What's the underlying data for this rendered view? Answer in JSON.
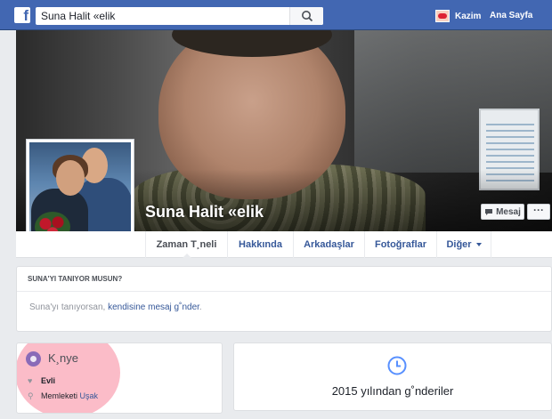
{
  "topbar": {
    "logo_letter": "f",
    "search_value": "Suna Halit «elik",
    "search_icon": "search-icon",
    "user_name": "Kazim",
    "home_label": "Ana Sayfa",
    "bar_color": "#4267b2"
  },
  "profile": {
    "name": "Suna Halit «elik",
    "message_button": "Mesaj",
    "more_button": "···"
  },
  "tabs": [
    {
      "label": "Zaman T¸neli"
    },
    {
      "label": "Hakkında"
    },
    {
      "label": "Arkadaşlar"
    },
    {
      "label": "Fotoğraflar"
    },
    {
      "label": "Diğer"
    }
  ],
  "know_card": {
    "heading": "SUNA'YI TANIYOR MUSUN?",
    "text_before": "Suna'yı tanıyorsan, ",
    "link": "kendisine mesaj g˚nder",
    "text_after": "."
  },
  "intro": {
    "title": "K¸nye",
    "icon": "globe-icon",
    "rows": [
      {
        "icon": "heart-icon",
        "label": "Evli",
        "value": ""
      },
      {
        "icon": "location-pin-icon",
        "label": "Memleketi",
        "value": "Uşak"
      }
    ]
  },
  "posts": {
    "icon": "clock-icon",
    "title": "2015 yılından g˚nderiler"
  }
}
